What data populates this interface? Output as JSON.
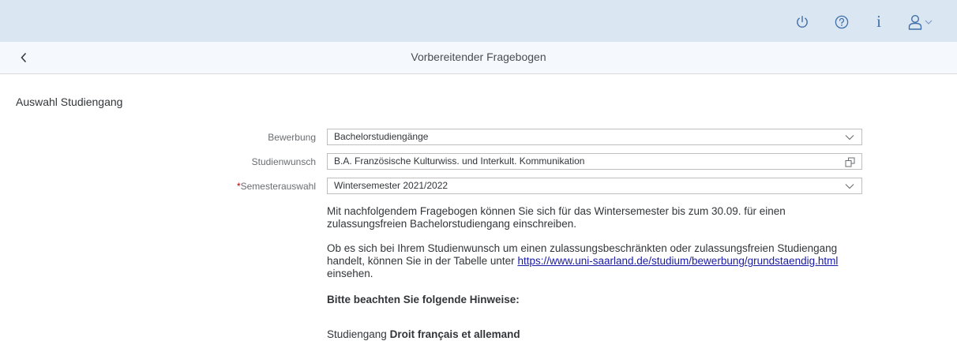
{
  "shell": {
    "icons": [
      "power-icon",
      "help-icon",
      "info-icon",
      "user-icon",
      "chevron-down-icon"
    ],
    "info_glyph": "i"
  },
  "nav": {
    "title": "Vorbereitender Fragebogen"
  },
  "section": {
    "title": "Auswahl Studiengang"
  },
  "form": {
    "bewerbung": {
      "label": "Bewerbung",
      "value": "Bachelorstudiengänge"
    },
    "studienwunsch": {
      "label": "Studienwunsch",
      "value": "B.A. Französische Kulturwiss. und Interkult. Kommunikation"
    },
    "semester": {
      "required_mark": "*",
      "label": "Semesterauswahl",
      "value": "Wintersemester 2021/2022"
    }
  },
  "info": {
    "p1": "Mit nachfolgendem Fragebogen können Sie sich für das Wintersemester bis zum 30.09. für einen zulassungsfreien Bachelorstudiengang einschreiben.",
    "p2_before": "Ob es sich bei Ihrem Studienwunsch um einen zulassungsbeschränkten oder zulassungsfreien Studiengang handelt, können Sie in der Tabelle unter ",
    "p2_link": "https://www.uni-saarland.de/studium/bewerbung/grundstaendig.html",
    "p2_after": " einsehen.",
    "heading": "Bitte beachten Sie folgende Hinweise:",
    "p3_prefix": "Studiengang ",
    "p3_bold": "Droit français et allemand"
  },
  "colors": {
    "shell_bg": "#dbe6f3",
    "nav_bg": "#f5f9fd",
    "icon_blue": "#3f6fa8",
    "required_red": "#bb0000",
    "link": "#1a1aa6"
  }
}
